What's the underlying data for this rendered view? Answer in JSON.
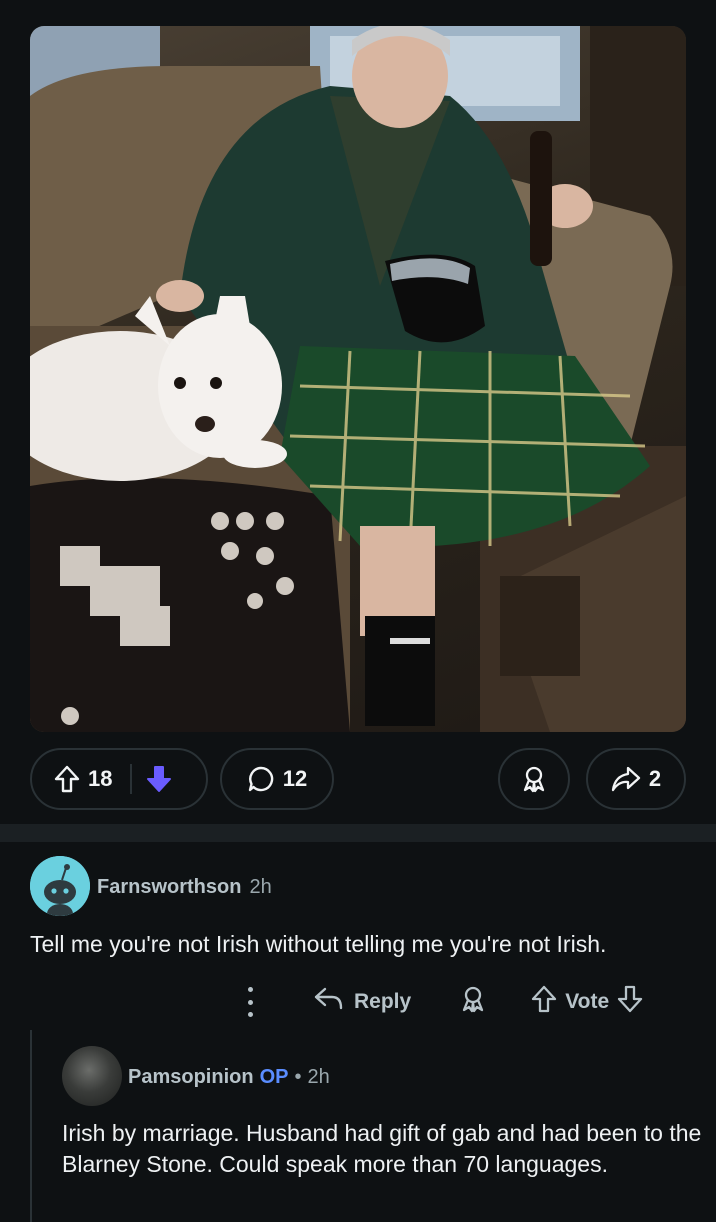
{
  "post": {
    "upvotes": "18",
    "comments": "12",
    "shares": "2"
  },
  "colors": {
    "background": "#0e1113",
    "downvote_active": "#6a5cff",
    "op_badge": "#5a8dff",
    "pill_border": "#2a3236"
  },
  "comments": [
    {
      "author": "Farnsworthson",
      "time": "2h",
      "text": "Tell me you're not Irish without telling me you're not Irish.",
      "actions": {
        "reply": "Reply",
        "vote": "Vote"
      }
    },
    {
      "author": "Pamsopinion",
      "badge": "OP",
      "separator": "•",
      "time": "2h",
      "text": "Irish by marriage. Husband had gift of gab and had been to the Blarney Stone. Could speak more than 70 languages."
    }
  ]
}
